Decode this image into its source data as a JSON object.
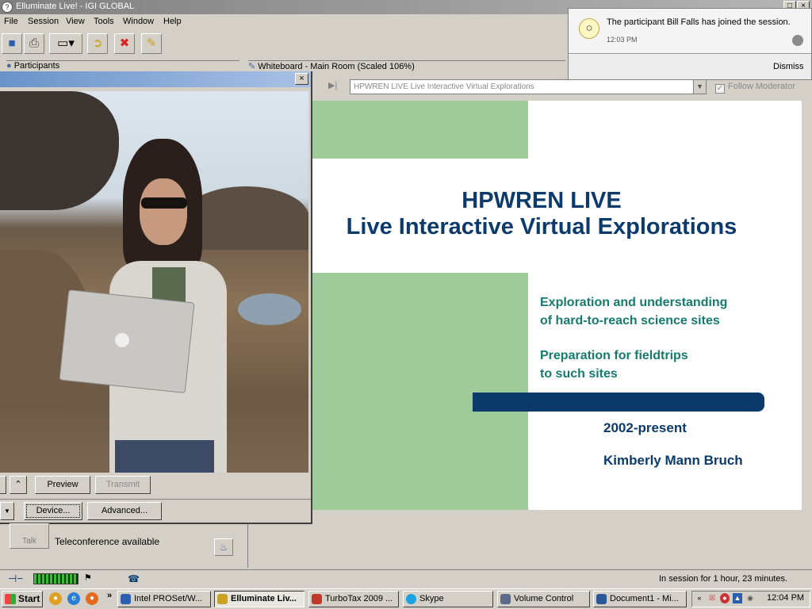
{
  "window": {
    "title": "Elluminate Live! - IGI GLOBAL",
    "controls": [
      "□",
      "×"
    ]
  },
  "menu": {
    "items": [
      "File",
      "Session",
      "View",
      "Tools",
      "Window",
      "Help"
    ]
  },
  "toolbar": {
    "icons": [
      "save-icon",
      "print-icon",
      "layout-icon",
      "share-icon",
      "disconnect-icon",
      "notes-icon"
    ]
  },
  "notification": {
    "message": "The participant Bill Falls has joined the session.",
    "time": "12:03 PM",
    "dismiss_label": "Dismiss"
  },
  "panels": {
    "participants_title": "Participants",
    "whiteboard_title": "Whiteboard - Main Room (Scaled 106%)"
  },
  "whiteboard": {
    "page_select_value": "HPWREN LIVE Live Interactive Virtual Explorations",
    "follow_moderator_label": "Follow Moderator",
    "follow_moderator_checked": true
  },
  "slide": {
    "title_line1": "HPWREN LIVE",
    "title_line2": "Live Interactive Virtual Explorations",
    "bullet1_line1": "Exploration and understanding",
    "bullet1_line2": "of hard-to-reach science sites",
    "bullet2_line1": "Preparation for fieldtrips",
    "bullet2_line2": "to such sites",
    "years": "2002-present",
    "author": "Kimberly Mann Bruch",
    "colors": {
      "green": "#9ecb99",
      "navy": "#0b3a6b",
      "teal": "#177a6e"
    }
  },
  "video": {
    "close_label": "×",
    "preview_label": "Preview",
    "transmit_label": "Transmit",
    "device_label": "Device...",
    "advanced_label": "Advanced..."
  },
  "audio": {
    "talk_label": "Talk",
    "teleconference_text": "Teleconference available"
  },
  "status": {
    "session_time": "In session for 1 hour, 23 minutes."
  },
  "taskbar": {
    "start_label": "Start",
    "tasks": [
      {
        "label": "Intel PROSet/W...",
        "color": "#2a5fb0"
      },
      {
        "label": "Elluminate Liv...",
        "color": "#c9a227",
        "active": true
      },
      {
        "label": "TurboTax 2009 ...",
        "color": "#c0392b"
      },
      {
        "label": "Skype",
        "color": "#1aa3e0"
      },
      {
        "label": "Volume Control",
        "color": "#5a6a8a"
      },
      {
        "label": "Document1 - Mi...",
        "color": "#2b5797"
      }
    ],
    "clock": "12:04 PM"
  }
}
